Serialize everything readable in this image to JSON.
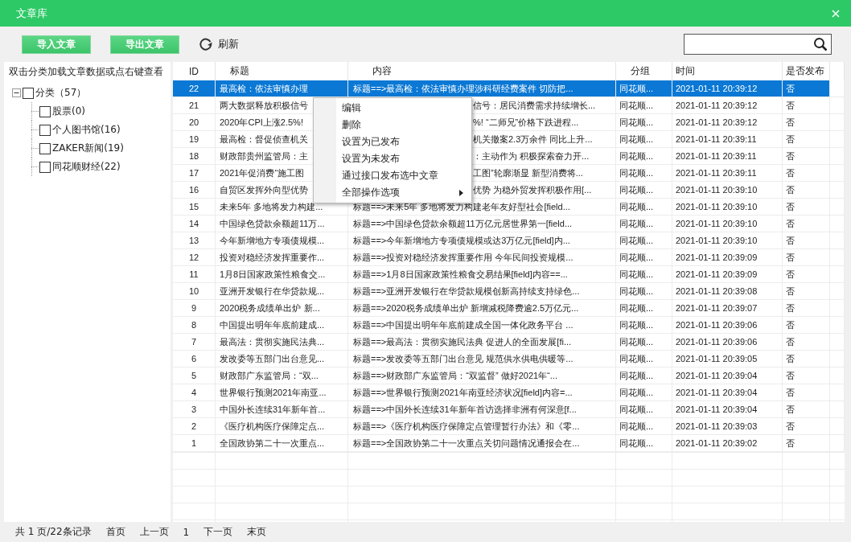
{
  "window": {
    "title": "文章库"
  },
  "toolbar": {
    "buttons": [
      "导入文章",
      "导出文章"
    ],
    "refresh": "刷新"
  },
  "sidebar": {
    "hint": "双击分类加载文章数据或点右键查看",
    "tree": [
      {
        "label": "分类（57）",
        "checked": false,
        "expanded": true,
        "children": [
          {
            "label": "股票(0)",
            "checked": false
          },
          {
            "label": "个人图书馆(16)",
            "checked": false
          },
          {
            "label": "ZAKER新闻(19)",
            "checked": false
          },
          {
            "label": "同花顺财经(22)",
            "checked": false
          }
        ]
      }
    ]
  },
  "table": {
    "columns": [
      "ID",
      "标题",
      "内容",
      "分组",
      "时间",
      "是否发布"
    ],
    "rows": [
      {
        "id": "22",
        "title": "最高检：依法审慎办理",
        "content": "标题==>最高检：依法审慎办理涉科研经费案件 切防把...",
        "group": "同花顺...",
        "time": "2021-01-11 20:39:12",
        "published": "否",
        "selected": true,
        "under_menu": false
      },
      {
        "id": "21",
        "title": "两大数据释放积极信号",
        "content": "信号：居民消费需求持续增长...",
        "group": "同花顺...",
        "time": "2021-01-11 20:39:12",
        "published": "否",
        "selected": false,
        "under_menu": true
      },
      {
        "id": "20",
        "title": "2020年CPI上涨2.5%!",
        "content": "%! “二师兄”价格下跌进程...",
        "group": "同花顺...",
        "time": "2021-01-11 20:39:12",
        "published": "否",
        "selected": false,
        "under_menu": true
      },
      {
        "id": "19",
        "title": "最高检：督促侦查机关",
        "content": "机关撤案2.3万余件 同比上升...",
        "group": "同花顺...",
        "time": "2021-01-11 20:39:11",
        "published": "否",
        "selected": false,
        "under_menu": true
      },
      {
        "id": "18",
        "title": "财政部贵州监管局：主",
        "content": "：主动作为 积极探索奋力开...",
        "group": "同花顺...",
        "time": "2021-01-11 20:39:11",
        "published": "否",
        "selected": false,
        "under_menu": true
      },
      {
        "id": "17",
        "title": "2021年促消费“施工图",
        "content": "工图”轮廓渐显 新型消费将...",
        "group": "同花顺...",
        "time": "2021-01-11 20:39:11",
        "published": "否",
        "selected": false,
        "under_menu": true
      },
      {
        "id": "16",
        "title": "自贸区发挥外向型优势",
        "content": "优势 为稳外贸发挥积极作用[...",
        "group": "同花顺...",
        "time": "2021-01-11 20:39:10",
        "published": "否",
        "selected": false,
        "under_menu": true
      },
      {
        "id": "15",
        "title": "未来5年 多地将发力构建...",
        "content": "标题==>未来5年 多地将发力构建老年友好型社会[field...",
        "group": "同花顺...",
        "time": "2021-01-11 20:39:10",
        "published": "否",
        "selected": false,
        "under_menu": false
      },
      {
        "id": "14",
        "title": "中国绿色贷款余额超11万...",
        "content": "标题==>中国绿色贷款余额超11万亿元居世界第一[field...",
        "group": "同花顺...",
        "time": "2021-01-11 20:39:10",
        "published": "否",
        "selected": false,
        "under_menu": false
      },
      {
        "id": "13",
        "title": "今年新增地方专项债规模...",
        "content": "标题==>今年新增地方专项债规模或达3万亿元[field]内...",
        "group": "同花顺...",
        "time": "2021-01-11 20:39:10",
        "published": "否",
        "selected": false,
        "under_menu": false
      },
      {
        "id": "12",
        "title": "投资对稳经济发挥重要作...",
        "content": "标题==>投资对稳经济发挥重要作用 今年民间投资规模...",
        "group": "同花顺...",
        "time": "2021-01-11 20:39:09",
        "published": "否",
        "selected": false,
        "under_menu": false
      },
      {
        "id": "11",
        "title": "1月8日国家政策性粮食交...",
        "content": "标题==>1月8日国家政策性粮食交易结果[field]内容==...",
        "group": "同花顺...",
        "time": "2021-01-11 20:39:09",
        "published": "否",
        "selected": false,
        "under_menu": false
      },
      {
        "id": "10",
        "title": "亚洲开发银行在华贷款规...",
        "content": "标题==>亚洲开发银行在华贷款规模创新高持续支持绿色...",
        "group": "同花顺...",
        "time": "2021-01-11 20:39:08",
        "published": "否",
        "selected": false,
        "under_menu": false
      },
      {
        "id": "9",
        "title": "2020税务成绩单出炉 新...",
        "content": "标题==>2020税务成绩单出炉 新增减税降费逾2.5万亿元...",
        "group": "同花顺...",
        "time": "2021-01-11 20:39:07",
        "published": "否",
        "selected": false,
        "under_menu": false
      },
      {
        "id": "8",
        "title": "中国提出明年年底前建成...",
        "content": "标题==>中国提出明年年底前建成全国一体化政务平台 ...",
        "group": "同花顺...",
        "time": "2021-01-11 20:39:06",
        "published": "否",
        "selected": false,
        "under_menu": false
      },
      {
        "id": "7",
        "title": "最高法：贯彻实施民法典...",
        "content": "标题==>最高法：贯彻实施民法典 促进人的全面发展[fi...",
        "group": "同花顺...",
        "time": "2021-01-11 20:39:06",
        "published": "否",
        "selected": false,
        "under_menu": false
      },
      {
        "id": "6",
        "title": "发改委等五部门出台意见...",
        "content": "标题==>发改委等五部门出台意见 规范供水供电供暖等...",
        "group": "同花顺...",
        "time": "2021-01-11 20:39:05",
        "published": "否",
        "selected": false,
        "under_menu": false
      },
      {
        "id": "5",
        "title": "财政部广东监管局：“双...",
        "content": "标题==>财政部广东监管局：“双监督” 做好2021年“...",
        "group": "同花顺...",
        "time": "2021-01-11 20:39:04",
        "published": "否",
        "selected": false,
        "under_menu": false
      },
      {
        "id": "4",
        "title": "世界银行预测2021年南亚...",
        "content": "标题==>世界银行预测2021年南亚经济状况[field]内容=...",
        "group": "同花顺...",
        "time": "2021-01-11 20:39:04",
        "published": "否",
        "selected": false,
        "under_menu": false
      },
      {
        "id": "3",
        "title": "中国外长连续31年新年首...",
        "content": "标题==>中国外长连续31年新年首访选择非洲有何深意[f...",
        "group": "同花顺...",
        "time": "2021-01-11 20:39:04",
        "published": "否",
        "selected": false,
        "under_menu": false
      },
      {
        "id": "2",
        "title": "《医疗机构医疗保障定点...",
        "content": "标题==>《医疗机构医疗保障定点管理暂行办法》和《零...",
        "group": "同花顺...",
        "time": "2021-01-11 20:39:03",
        "published": "否",
        "selected": false,
        "under_menu": false
      },
      {
        "id": "1",
        "title": "全国政协第二十一次重点...",
        "content": "标题==>全国政协第二十一次重点关切问题情况通报会在...",
        "group": "同花顺...",
        "time": "2021-01-11 20:39:02",
        "published": "否",
        "selected": false,
        "under_menu": false
      }
    ]
  },
  "context_menu": {
    "items": [
      {
        "label": "编辑",
        "submenu": false
      },
      {
        "label": "删除",
        "submenu": false
      },
      {
        "label": "设置为已发布",
        "submenu": false
      },
      {
        "label": "设置为未发布",
        "submenu": false
      },
      {
        "label": "通过接口发布选中文章",
        "submenu": false
      },
      {
        "label": "全部操作选项",
        "submenu": true
      }
    ]
  },
  "pager": {
    "summary": "共 1 页/22条记录",
    "links": [
      "首页",
      "上一页",
      "1",
      "下一页",
      "末页"
    ]
  }
}
